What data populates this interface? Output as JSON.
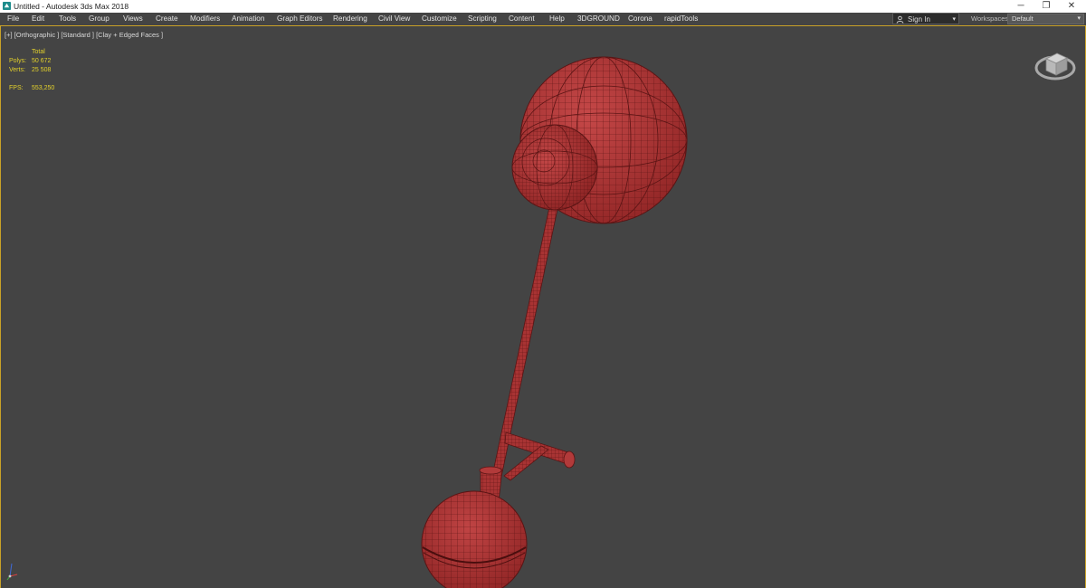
{
  "window": {
    "title": "Untitled - Autodesk 3ds Max 2018",
    "icons": {
      "app": "3dsmax-app-icon",
      "minimize": "minimize-icon",
      "restore": "restore-icon",
      "close": "close-icon"
    },
    "controls": {
      "minimize": "─",
      "restore": "❐",
      "close": "✕"
    }
  },
  "menubar": {
    "items": [
      "File",
      "Edit",
      "Tools",
      "Group",
      "Views",
      "Create",
      "Modifiers",
      "Animation",
      "Graph Editors",
      "Rendering",
      "Civil View",
      "Customize",
      "Scripting",
      "Content",
      "Help",
      "3DGROUND",
      "Corona",
      "rapidTools"
    ],
    "sign_in": {
      "label": "Sign In",
      "icon": "user-icon",
      "chevron": "▾"
    },
    "workspaces": {
      "label": "Workspaces:",
      "value": "Default",
      "chevron": "▾"
    }
  },
  "viewport": {
    "label": "[+] [Orthographic ] [Standard ] [Clay + Edged Faces ]",
    "stats": {
      "header": "Total",
      "polys_label": "Polys:",
      "polys_value": "50 672",
      "verts_label": "Verts:",
      "verts_value": "25 508",
      "fps_label": "FPS:",
      "fps_value": "553,250"
    },
    "viewcube_icon": "viewcube-icon",
    "axis_icon": "axis-tripod-icon",
    "colors": {
      "background": "#444444",
      "model_fill": "#b23a3a",
      "wire": "#5a1414",
      "stats_text": "#e3d12b",
      "active_border": "#c9a227"
    }
  }
}
